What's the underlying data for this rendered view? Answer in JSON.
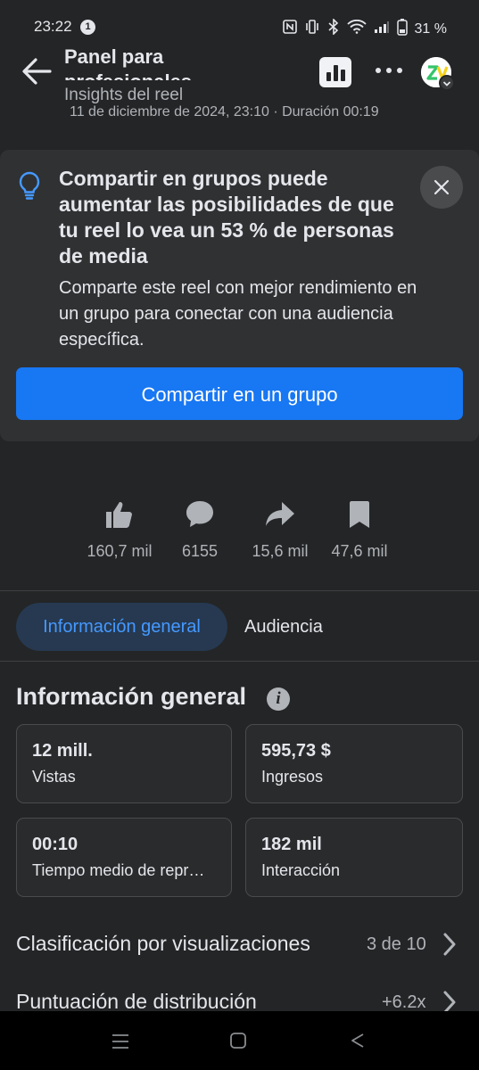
{
  "status_bar": {
    "time": "23:22",
    "notification_count": "1",
    "battery": "31 %"
  },
  "header": {
    "title": "Panel para profesionales",
    "subtitle": "Insights del reel",
    "date_line": "11 de diciembre de 2024, 23:10 · Duración 00:19"
  },
  "banner": {
    "title": "Compartir en grupos puede aumentar las posibilidades de que tu reel lo vea un 53 % de personas de media",
    "body": "Comparte este reel con mejor rendimiento en un grupo para conectar con una audiencia específica.",
    "button_label": "Compartir en un grupo"
  },
  "reactions": [
    {
      "icon": "thumbs-up-icon",
      "value": "160,7 mil"
    },
    {
      "icon": "comment-icon",
      "value": "6155"
    },
    {
      "icon": "share-icon",
      "value": "15,6 mil"
    },
    {
      "icon": "bookmark-icon",
      "value": "47,6 mil"
    }
  ],
  "tabs": [
    {
      "label": "Información general",
      "active": true
    },
    {
      "label": "Audiencia",
      "active": false
    }
  ],
  "overview": {
    "title": "Información general",
    "cards": [
      {
        "value": "12 mill.",
        "label": "Vistas"
      },
      {
        "value": "595,73 $",
        "label": "Ingresos"
      },
      {
        "value": "00:10",
        "label": "Tiempo medio de repr…"
      },
      {
        "value": "182 mil",
        "label": "Interacción"
      }
    ]
  },
  "rows": [
    {
      "label": "Clasificación por visualizaciones",
      "value": "3 de 10"
    },
    {
      "label": "Puntuación de distribución",
      "value": "+6.2x"
    }
  ],
  "colors": {
    "background": "#242526",
    "accent": "#1877f2",
    "tab_active_bg": "#263951",
    "tab_active_text": "#4599ff"
  }
}
